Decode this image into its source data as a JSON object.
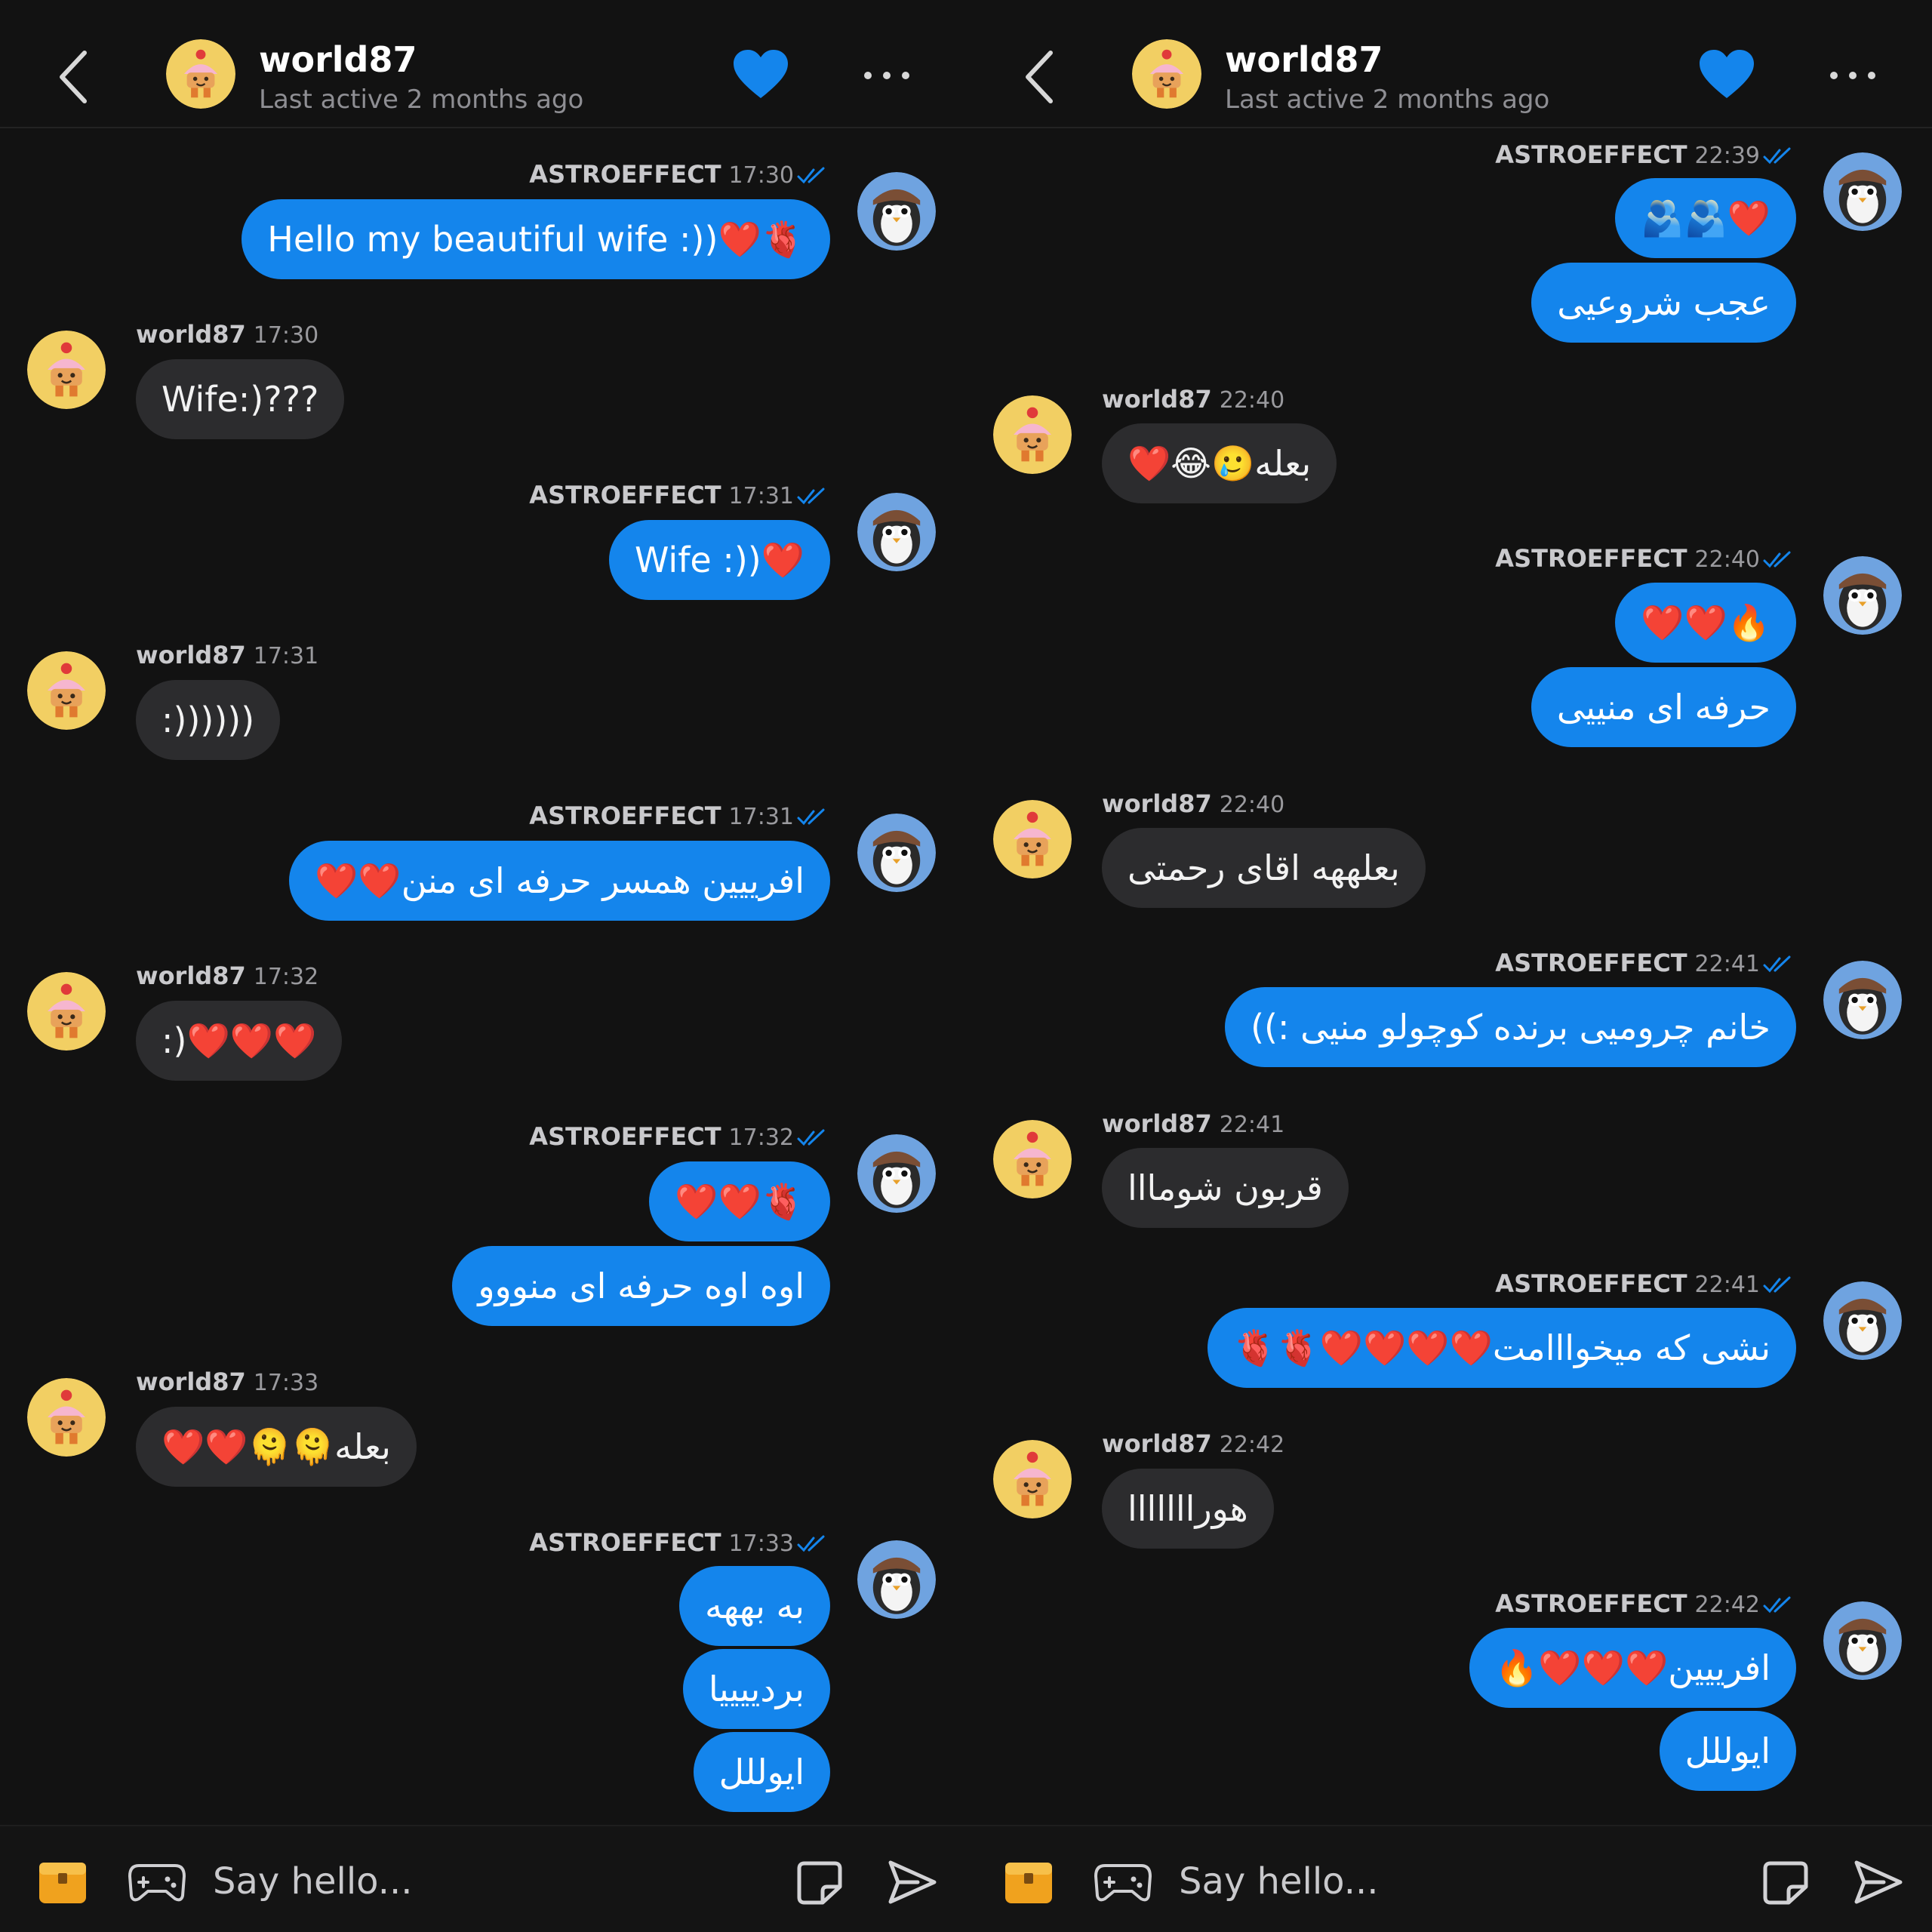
{
  "colors": {
    "bubble_out": "#1485ec",
    "bubble_in": "#2c2c2e",
    "background": "#121212",
    "accent": "#1485ec"
  },
  "left": {
    "header": {
      "name": "world87",
      "status": "Last active 2 months ago"
    },
    "messages": [
      {
        "sender": "ASTROEFFECT",
        "time": "17:30",
        "text": "Hello my beautiful wife :))❤️🫀"
      },
      {
        "sender": "world87",
        "time": "17:30",
        "text": "Wife:)???"
      },
      {
        "sender": "ASTROEFFECT",
        "time": "17:31",
        "text": "Wife :))❤️"
      },
      {
        "sender": "world87",
        "time": "17:31",
        "text": ":))))))"
      },
      {
        "sender": "ASTROEFFECT",
        "time": "17:31",
        "text": "افرییین همسر حرفه ای منن❤️❤️"
      },
      {
        "sender": "world87",
        "time": "17:32",
        "text": ":)❤️❤️❤️"
      },
      {
        "sender": "ASTROEFFECT",
        "time": "17:32",
        "texts": [
          "❤️❤️🫀",
          "اوه اوه حرفه ای منووو"
        ]
      },
      {
        "sender": "world87",
        "time": "17:33",
        "text": "بعله🫠🫠❤️❤️"
      },
      {
        "sender": "ASTROEFFECT",
        "time": "17:33",
        "texts": [
          "به بههه",
          "بردییییا",
          "ایوللل"
        ]
      }
    ],
    "footer": {
      "placeholder": "Say hello..."
    }
  },
  "right": {
    "header": {
      "name": "world87",
      "status": "Last active 2 months ago"
    },
    "messages": [
      {
        "sender": "ASTROEFFECT",
        "time": "22:39",
        "texts": [
          "🫂🫂❤️",
          "عجب شروعیی"
        ]
      },
      {
        "sender": "world87",
        "time": "22:40",
        "text": "بعله🥲😂❤️"
      },
      {
        "sender": "ASTROEFFECT",
        "time": "22:40",
        "texts": [
          "❤️❤️🔥",
          "حرفه ای منییی"
        ]
      },
      {
        "sender": "world87",
        "time": "22:40",
        "text": "بعلههه اقای رحمتی"
      },
      {
        "sender": "ASTROEFFECT",
        "time": "22:41",
        "text": "خانم چرومیی برنده کوچولو منیی :))"
      },
      {
        "sender": "world87",
        "time": "22:41",
        "text": "قربون شومااا"
      },
      {
        "sender": "ASTROEFFECT",
        "time": "22:41",
        "text": "نشی که میخوااامت❤️❤️❤️❤️🫀🫀"
      },
      {
        "sender": "world87",
        "time": "22:42",
        "text": "هورااااااا"
      },
      {
        "sender": "ASTROEFFECT",
        "time": "22:42",
        "texts": [
          "افرییین❤️❤️❤️🔥",
          "ایوللل"
        ]
      }
    ],
    "footer": {
      "placeholder": "Say hello..."
    }
  }
}
